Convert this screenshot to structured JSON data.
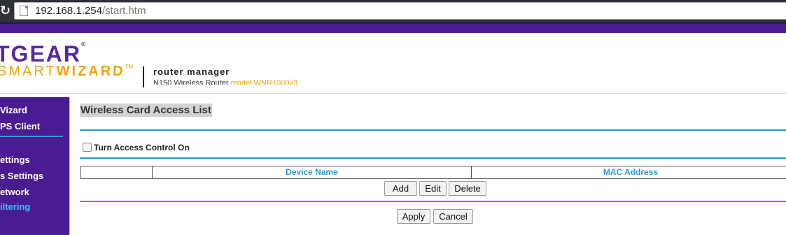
{
  "browser": {
    "url_host": "192.168.1.254",
    "url_path": "/start.htm"
  },
  "header": {
    "brand": "TGEAR",
    "brand_mark": "®",
    "smart": "SMART",
    "wizard": "WIZARD",
    "tm": "TM",
    "router_manager": "router manager",
    "product_line": "N150 Wireless Router",
    "model": "model WNR1000v3"
  },
  "sidebar": {
    "items": [
      {
        "label": "Vizard"
      },
      {
        "label": "PS Client"
      },
      {
        "label": "ettings"
      },
      {
        "label": "s Settings"
      },
      {
        "label": "etwork"
      },
      {
        "label": "iltering",
        "active": true
      }
    ]
  },
  "main": {
    "title": "Wireless Card Access List",
    "checkbox_label": "Turn Access Control On",
    "checkbox_checked": false,
    "table": {
      "columns": [
        "",
        "Device Name",
        "MAC Address"
      ]
    },
    "buttons": {
      "add": "Add",
      "edit": "Edit",
      "delete": "Delete",
      "apply": "Apply",
      "cancel": "Cancel"
    }
  },
  "colors": {
    "sidebar_bg": "#4a1c92",
    "accent_blue": "#2a9ad3",
    "brand_purple": "#5a2a9c",
    "brand_orange": "#f0a500"
  }
}
